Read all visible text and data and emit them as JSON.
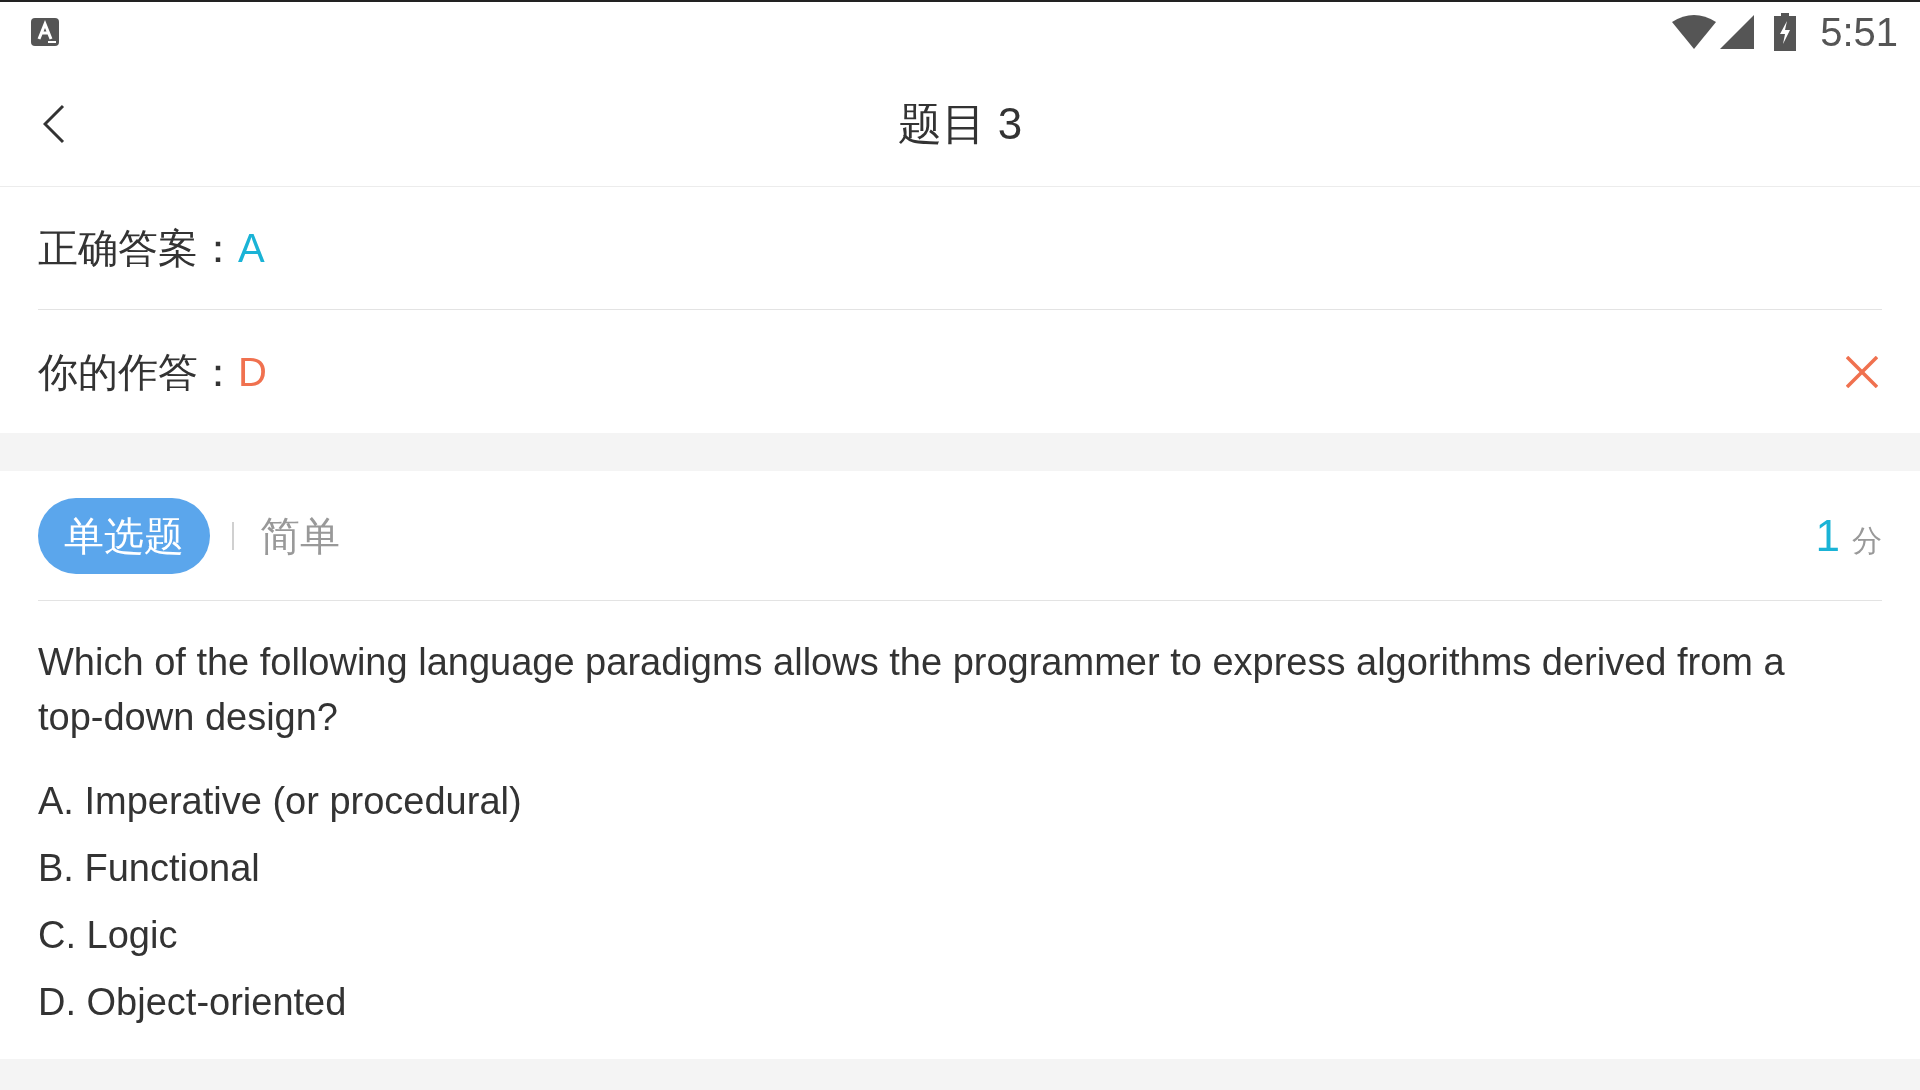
{
  "status_bar": {
    "time": "5:51"
  },
  "header": {
    "title": "题目 3"
  },
  "answers": [
    {
      "kind": "key",
      "label": "正确答案：",
      "value": "A"
    },
    {
      "kind": "response",
      "label": "你的作答：",
      "value": "D",
      "correct": false
    }
  ],
  "question": {
    "type_tag": "单选题",
    "difficulty": "简单",
    "score": "1",
    "score_unit": "分",
    "text": "Which of the following language paradigms allows the programmer to express algorithms derived from a top-down design?",
    "options": [
      "A. Imperative (or procedural)",
      "B. Functional",
      "C. Logic",
      "D. Object-oriented"
    ]
  }
}
